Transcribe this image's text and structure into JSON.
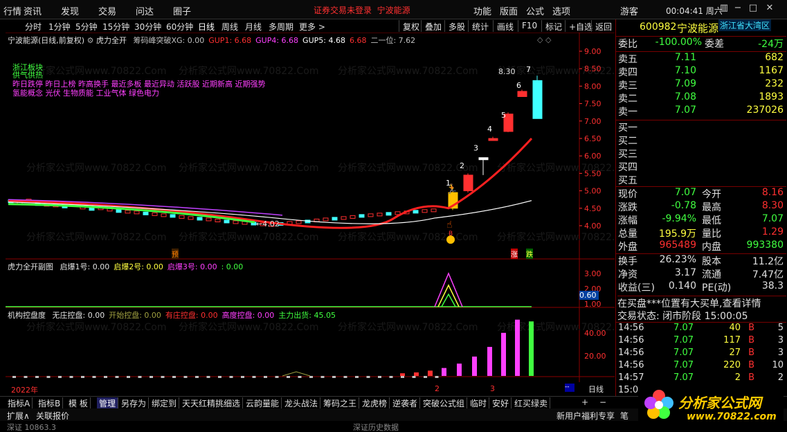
{
  "menubar": {
    "items": [
      "行情",
      "资讯",
      "发现",
      "交易",
      "问达",
      "圈子"
    ],
    "warning": "证券交易未登录",
    "stock_name": "宁波能源",
    "right_items": [
      "功能",
      "版面",
      "公式",
      "选项"
    ],
    "guest": "游客",
    "time": "00:04:41 周六"
  },
  "periods": {
    "items": [
      "分时",
      "1分钟",
      "5分钟",
      "15分钟",
      "30分钟",
      "60分钟",
      "日线",
      "周线",
      "月线",
      "多周期",
      "更多 >"
    ],
    "active": "日线"
  },
  "toolbar": {
    "items": [
      "复权",
      "叠加",
      "多股",
      "统计",
      "画线",
      "F10",
      "标记",
      "+自选",
      "返回"
    ]
  },
  "main_chart": {
    "title": "宁波能源(日线,前复权)",
    "indicator_title": "虎力全开",
    "indicator_items": [
      {
        "label": "筹码峰突破XG: 0.00",
        "color": "#c0c0c0"
      },
      {
        "label": "GUP1: 6.68",
        "color": "#ff3030"
      },
      {
        "label": "GUP4: 6.68",
        "color": "#ff40ff"
      },
      {
        "label": "GUP5: 4.68",
        "color": "#ffffff"
      },
      {
        "label": "6.68",
        "color": "#ff3030"
      },
      {
        "label": "二一位: 7.62",
        "color": "#c0c0c0"
      }
    ],
    "annot_line1": "浙江板块",
    "annot_line2": "供气供热",
    "annot_line3": "昨日跌停 昨日上榜 昨高换手 最近多板 最近异动 活跃股 近期新高 近期强势",
    "annot_line4": "氢能概念 光伏 生物质能 工业气体 绿色电力",
    "price_axis": [
      "9.00",
      "8.50",
      "8.00",
      "7.50",
      "7.00",
      "6.50",
      "6.00",
      "5.50",
      "5.00",
      "4.50",
      "4.00"
    ],
    "high_label": "8.30",
    "low_label": "4.02",
    "board_counts": [
      "1",
      "2",
      "3",
      "4",
      "5",
      "6",
      "7"
    ],
    "marker_yu": "预",
    "marker_zhang": "涨",
    "marker_die": "跌",
    "watermark": "分析家公式网www.70822.Com"
  },
  "sub1": {
    "title": "虎力全开副图",
    "items": [
      {
        "label": "启爆1号: 0.00",
        "color": "#e0e0e0"
      },
      {
        "label": "启爆2号: 0.00",
        "color": "#ffff40"
      },
      {
        "label": "启爆3号: 0.00",
        "color": "#ff40ff"
      },
      {
        "label": ": 0.00",
        "color": "#40ff40"
      }
    ],
    "axis": [
      "3.00",
      "2.00",
      "1.00"
    ],
    "value_tag": "0.60"
  },
  "sub2": {
    "title": "机构控盘度",
    "items": [
      {
        "label": "无庄控盘: 0.00",
        "color": "#e0e0e0"
      },
      {
        "label": "开始控盘: 0.00",
        "color": "#a0a040"
      },
      {
        "label": "有庄控盘: 0.00",
        "color": "#ff3030"
      },
      {
        "label": "高度控盘: 0.00",
        "color": "#ff40ff"
      },
      {
        "label": "主力出货: 45.05",
        "color": "#40ff40"
      }
    ],
    "axis": [
      "40.00",
      "20.00"
    ]
  },
  "date_axis": {
    "year": "2022年",
    "m2": "2",
    "m3": "3",
    "period": "日线"
  },
  "quote": {
    "code": "600982",
    "name": "宁波能源",
    "region": "浙江省大湾区",
    "weibi_label": "委比",
    "weibi": "-100.00%",
    "weicha_label": "委差",
    "weicha": "-24万",
    "sells": [
      {
        "label": "卖五",
        "price": "7.11",
        "vol": "682"
      },
      {
        "label": "卖四",
        "price": "7.10",
        "vol": "1167"
      },
      {
        "label": "卖三",
        "price": "7.09",
        "vol": "232"
      },
      {
        "label": "卖二",
        "price": "7.08",
        "vol": "1893"
      },
      {
        "label": "卖一",
        "price": "7.07",
        "vol": "237026"
      }
    ],
    "buys": [
      "买一",
      "买二",
      "买三",
      "买四",
      "买五"
    ],
    "stats": [
      {
        "l1": "现价",
        "v1": "7.07",
        "c1": "#40ff40",
        "l2": "今开",
        "v2": "8.16",
        "c2": "#ff3030"
      },
      {
        "l1": "涨跌",
        "v1": "-0.78",
        "c1": "#40ff40",
        "l2": "最高",
        "v2": "8.30",
        "c2": "#ff3030"
      },
      {
        "l1": "涨幅",
        "v1": "-9.94%",
        "c1": "#40ff40",
        "l2": "最低",
        "v2": "7.07",
        "c2": "#40ff40"
      },
      {
        "l1": "总量",
        "v1": "195.9万",
        "c1": "#ffff40",
        "l2": "量比",
        "v2": "1.29",
        "c2": "#ff3030"
      },
      {
        "l1": "外盘",
        "v1": "965489",
        "c1": "#ff3030",
        "l2": "内盘",
        "v2": "993380",
        "c2": "#40ff40"
      }
    ],
    "stats2": [
      {
        "l1": "换手",
        "v1": "26.23%",
        "l2": "股本",
        "v2": "11.2亿"
      },
      {
        "l1": "净资",
        "v1": "3.17",
        "l2": "流通",
        "v2": "7.47亿"
      },
      {
        "l1": "收益(三)",
        "v1": "0.140",
        "l2": "PE(动)",
        "v2": "38.3"
      }
    ],
    "notice": "在买盘***位置有大买单,查看详情",
    "state_label": "交易状态: 闭市阶段 15:00:05",
    "ticks": [
      {
        "t": "14:56",
        "p": "7.07",
        "v": "40",
        "bs": "B",
        "n": "5"
      },
      {
        "t": "14:56",
        "p": "7.07",
        "v": "117",
        "bs": "B",
        "n": "3"
      },
      {
        "t": "14:56",
        "p": "7.07",
        "v": "27",
        "bs": "B",
        "n": "3"
      },
      {
        "t": "14:56",
        "p": "7.07",
        "v": "220",
        "bs": "B",
        "n": "10"
      },
      {
        "t": "14:57",
        "p": "7.07",
        "v": "2",
        "bs": "B",
        "n": "2"
      },
      {
        "t": "15:00",
        "p": "",
        "v": "",
        "bs": "",
        "n": ""
      }
    ]
  },
  "bottom_tabs": [
    "指标A",
    "指标B",
    "模 板",
    "管理",
    "另存为",
    "绑定到",
    "天天红精挑细选",
    "云韵量能",
    "龙头战法",
    "筹码之王",
    "龙虎榜",
    "逆袭者",
    "突破公式组",
    "临时",
    "安好",
    "红买绿卖"
  ],
  "bottom2": {
    "expand": "扩展∧",
    "report": "关联报价",
    "welfare": "新用户福利专享",
    "pen": "笔"
  },
  "bottom3": {
    "left": "深证 10863.3",
    "mid": "深证历史数据"
  },
  "logo": {
    "cn": "分析家公式网",
    "url": "www.70822.com"
  }
}
